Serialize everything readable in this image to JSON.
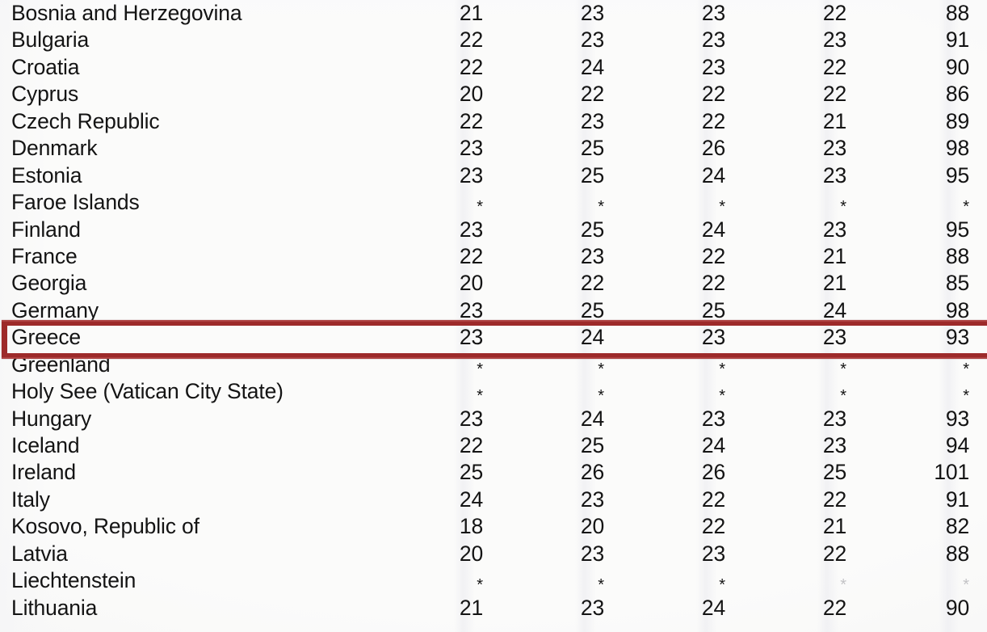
{
  "document": {
    "type": "scanned-statistics-table",
    "highlighted_row": "Greece",
    "missing_value_marker": "*"
  },
  "columns": [
    {
      "key": "col1",
      "label": ""
    },
    {
      "key": "col2",
      "label": ""
    },
    {
      "key": "col3",
      "label": ""
    },
    {
      "key": "col4",
      "label": ""
    },
    {
      "key": "col5",
      "label": ""
    }
  ],
  "colors": {
    "highlight_border": "#9d2a2a",
    "text": "#141414",
    "background": "#fbfbfa"
  },
  "rows": [
    {
      "country": "Bosnia and Herzegovina",
      "values": [
        "21",
        "23",
        "23",
        "22",
        "88"
      ]
    },
    {
      "country": "Bulgaria",
      "values": [
        "22",
        "23",
        "23",
        "23",
        "91"
      ]
    },
    {
      "country": "Croatia",
      "values": [
        "22",
        "24",
        "23",
        "22",
        "90"
      ]
    },
    {
      "country": "Cyprus",
      "values": [
        "20",
        "22",
        "22",
        "22",
        "86"
      ]
    },
    {
      "country": "Czech Republic",
      "values": [
        "22",
        "23",
        "22",
        "21",
        "89"
      ]
    },
    {
      "country": "Denmark",
      "values": [
        "23",
        "25",
        "26",
        "23",
        "98"
      ]
    },
    {
      "country": "Estonia",
      "values": [
        "23",
        "25",
        "24",
        "23",
        "95"
      ]
    },
    {
      "country": "Faroe Islands",
      "values": [
        "*",
        "*",
        "*",
        "*",
        "*"
      ]
    },
    {
      "country": "Finland",
      "values": [
        "23",
        "25",
        "24",
        "23",
        "95"
      ]
    },
    {
      "country": "France",
      "values": [
        "22",
        "23",
        "22",
        "21",
        "88"
      ]
    },
    {
      "country": "Georgia",
      "values": [
        "20",
        "22",
        "22",
        "21",
        "85"
      ]
    },
    {
      "country": "Germany",
      "values": [
        "23",
        "25",
        "25",
        "24",
        "98"
      ]
    },
    {
      "country": "Greece",
      "values": [
        "23",
        "24",
        "23",
        "23",
        "93"
      ]
    },
    {
      "country": "Greenland",
      "values": [
        "*",
        "*",
        "*",
        "*",
        "*"
      ]
    },
    {
      "country": "Holy See (Vatican City State)",
      "values": [
        "*",
        "*",
        "*",
        "*",
        "*"
      ]
    },
    {
      "country": "Hungary",
      "values": [
        "23",
        "24",
        "23",
        "23",
        "93"
      ]
    },
    {
      "country": "Iceland",
      "values": [
        "22",
        "25",
        "24",
        "23",
        "94"
      ]
    },
    {
      "country": "Ireland",
      "values": [
        "25",
        "26",
        "26",
        "25",
        "101"
      ]
    },
    {
      "country": "Italy",
      "values": [
        "24",
        "23",
        "22",
        "22",
        "91"
      ]
    },
    {
      "country": "Kosovo, Republic of",
      "values": [
        "18",
        "20",
        "22",
        "21",
        "82"
      ]
    },
    {
      "country": "Latvia",
      "values": [
        "20",
        "23",
        "23",
        "22",
        "88"
      ]
    },
    {
      "country": "Liechtenstein",
      "values": [
        "*",
        "*",
        "*",
        "*",
        "*"
      ]
    },
    {
      "country": "Lithuania",
      "values": [
        "21",
        "23",
        "24",
        "22",
        "90"
      ]
    }
  ]
}
